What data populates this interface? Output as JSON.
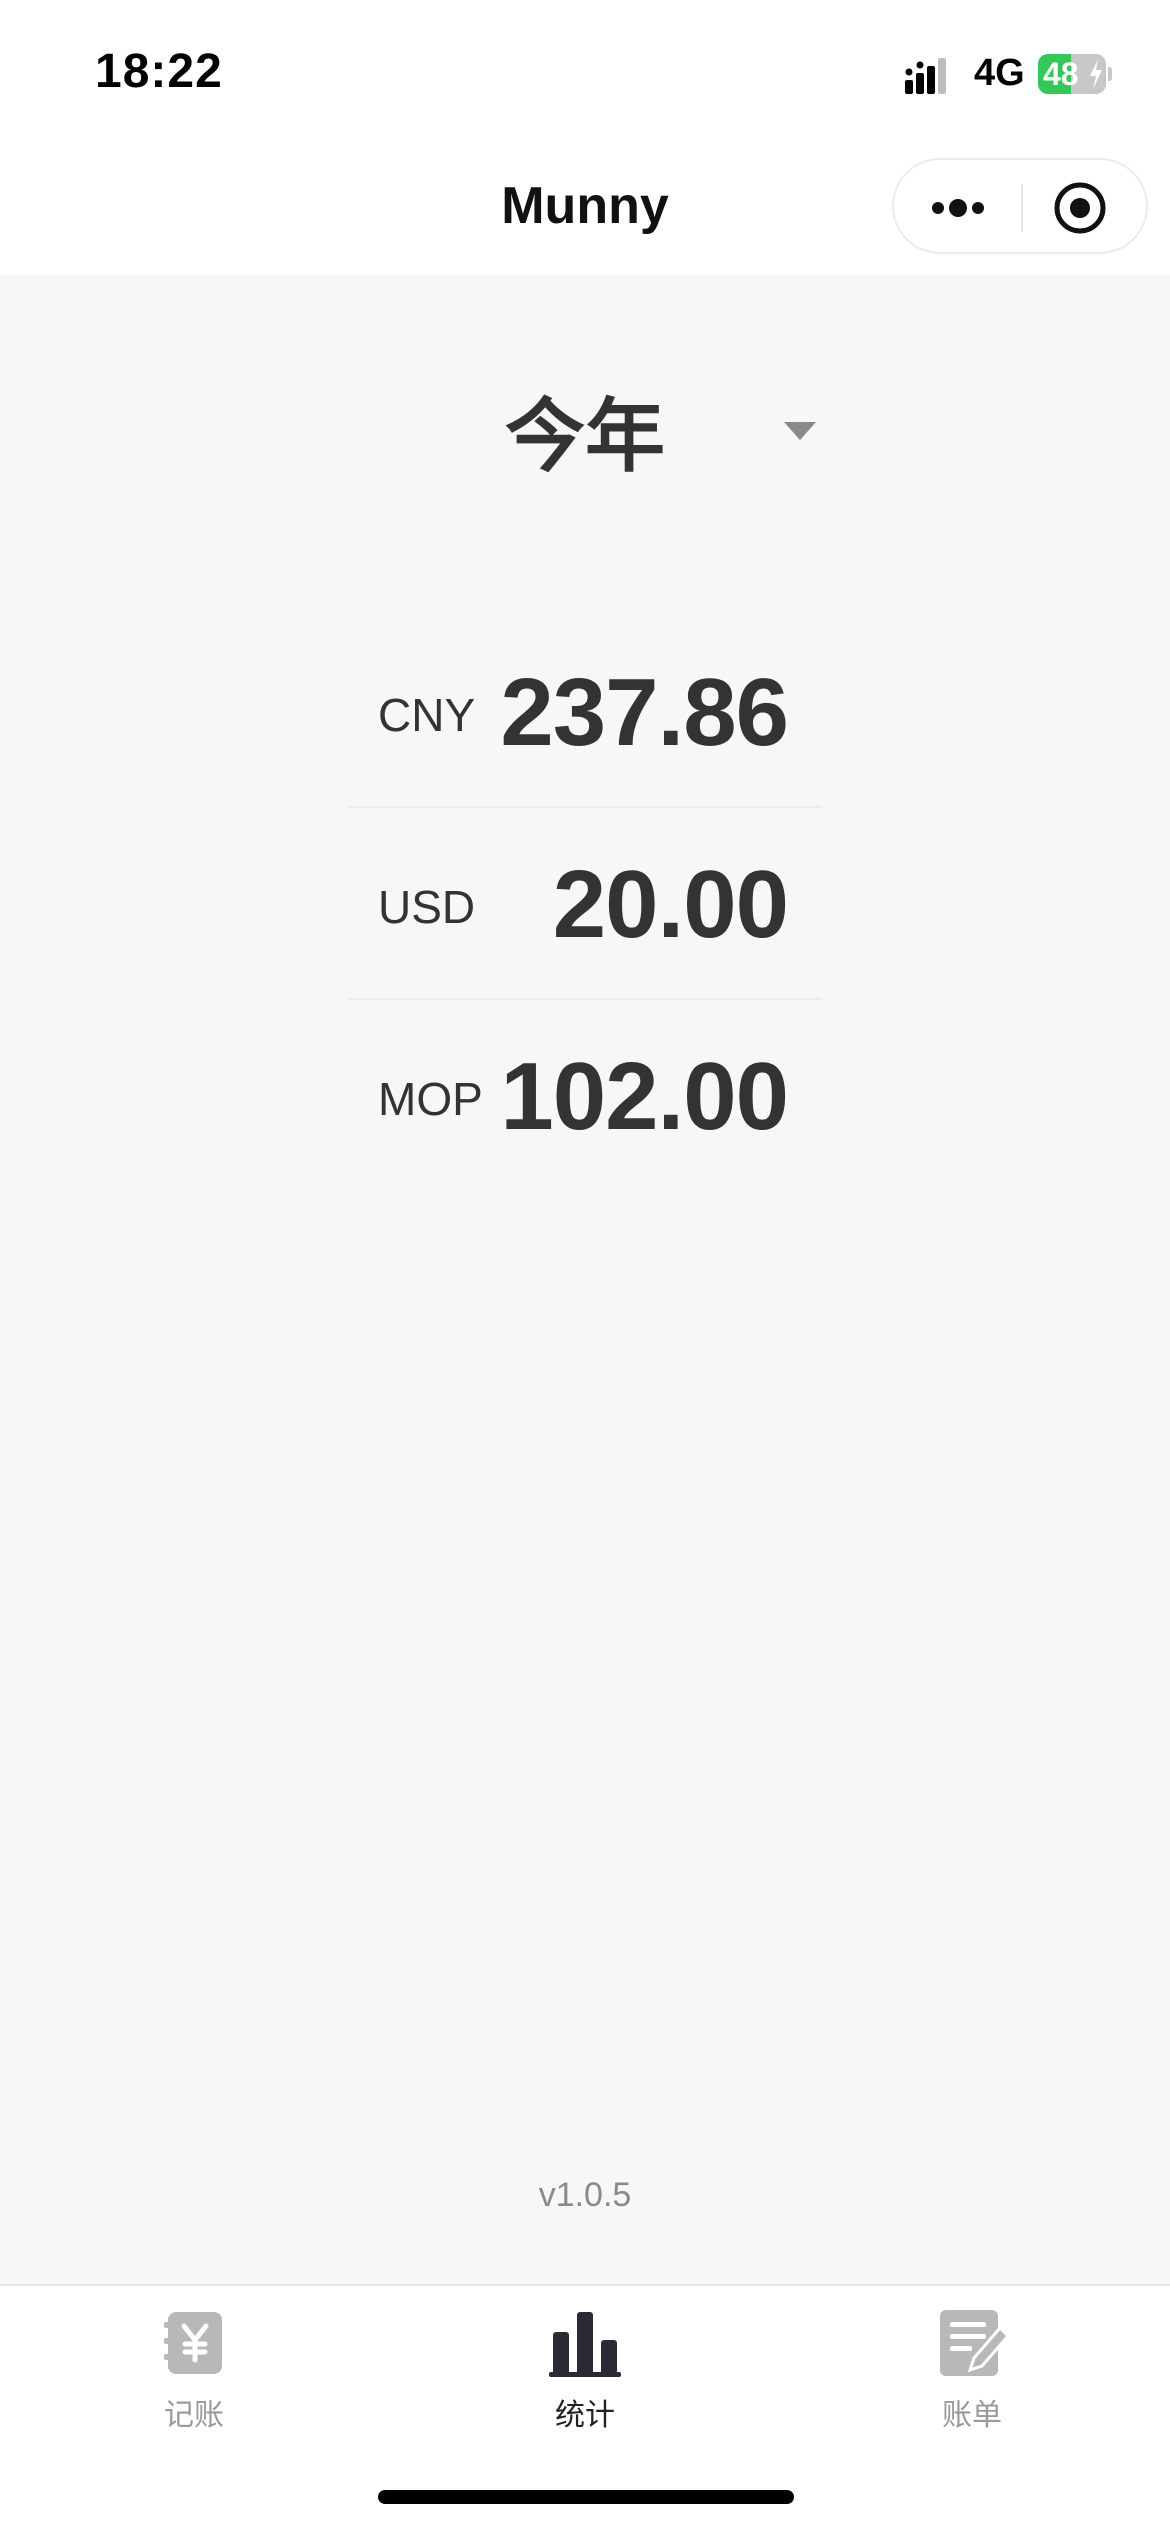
{
  "status_bar": {
    "time": "18:22",
    "network": "4G",
    "battery_level": "48",
    "battery_fraction": 0.48,
    "icons": [
      "signal-icon",
      "battery-charging-icon"
    ]
  },
  "nav": {
    "title": "Munny",
    "capsule_icons": [
      "more-dots-icon",
      "close-target-icon"
    ]
  },
  "period": {
    "label": "今年",
    "icon": "caret-down-icon"
  },
  "totals": [
    {
      "currency": "CNY",
      "amount": "237.86"
    },
    {
      "currency": "USD",
      "amount": "20.00"
    },
    {
      "currency": "MOP",
      "amount": "102.00"
    }
  ],
  "footer": {
    "version": "v1.0.5"
  },
  "tabbar": {
    "items": [
      {
        "label": "记账",
        "icon": "yen-ledger-icon",
        "active": false
      },
      {
        "label": "统计",
        "icon": "bar-chart-icon",
        "active": true
      },
      {
        "label": "账单",
        "icon": "bill-edit-icon",
        "active": false
      }
    ]
  },
  "colors": {
    "background": "#f7f7f7",
    "text": "#333333",
    "battery_green": "#34c759",
    "tab_active": "#222222",
    "tab_inactive": "#9a9a9a"
  }
}
